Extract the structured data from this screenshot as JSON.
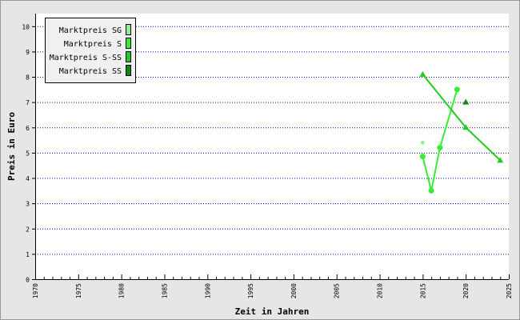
{
  "chart_data": {
    "type": "line",
    "xlabel": "Zeit in Jahren",
    "ylabel": "Preis in Euro",
    "xlim": [
      1970,
      2025
    ],
    "ylim": [
      0,
      10.5
    ],
    "x_ticks": [
      1970,
      1975,
      1980,
      1985,
      1990,
      1995,
      2000,
      2005,
      2010,
      2015,
      2020,
      2025
    ],
    "y_ticks": [
      0,
      1,
      2,
      3,
      4,
      5,
      6,
      7,
      8,
      9,
      10
    ],
    "grid": "horizontal dotted",
    "legend": "top-left",
    "colors": {
      "plot_bg": "#ffffff",
      "frame_bg": "#e6e6e6",
      "grid": "#0000aa",
      "legend_bg": "#f0f0f0"
    },
    "series": [
      {
        "name": "Marktpreis SG",
        "color": "#8ff08f",
        "marker": "diamond",
        "points": [
          [
            2015,
            5.4
          ]
        ]
      },
      {
        "name": "Marktpreis S",
        "color": "#33ee33",
        "marker": "circle",
        "points": [
          [
            2015,
            4.85
          ],
          [
            2016,
            3.5
          ],
          [
            2017,
            5.2
          ],
          [
            2019,
            7.5
          ]
        ]
      },
      {
        "name": "Marktpreis S-SS",
        "color": "#22cc22",
        "marker": "triangle",
        "points": [
          [
            2015,
            8.1
          ],
          [
            2020,
            6.0
          ],
          [
            2024,
            4.7
          ]
        ]
      },
      {
        "name": "Marktpreis SS",
        "color": "#118811",
        "marker": "triangle",
        "points": [
          [
            2020,
            7.0
          ]
        ]
      }
    ]
  }
}
